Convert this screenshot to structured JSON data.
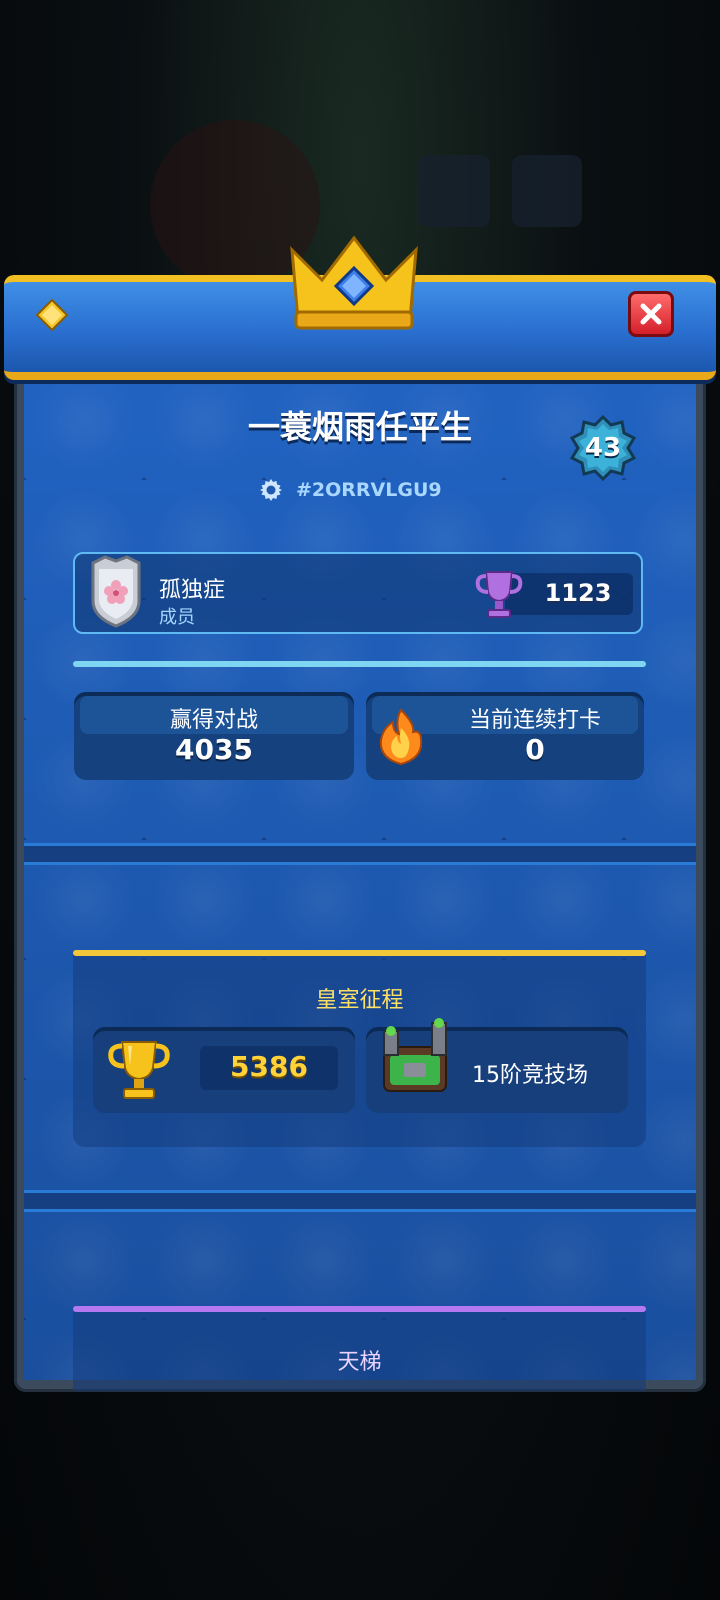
{
  "player": {
    "name": "一蓑烟雨任平生",
    "tag": "#2ORRVLGU9",
    "level": "43"
  },
  "clan": {
    "name": "孤独症",
    "role": "成员",
    "trophies": "1123"
  },
  "stats": {
    "wins_label": "赢得对战",
    "wins_value": "4035",
    "streak_label": "当前连续打卡",
    "streak_value": "0"
  },
  "path_of_legends": {
    "title": "皇室征程",
    "trophies": "5386",
    "arena": "15阶竞技场"
  },
  "ladder": {
    "title": "天梯"
  },
  "icons": {
    "close": "close-icon",
    "gear": "gear-icon",
    "crown": "crown-icon",
    "diamond": "diamond-icon",
    "flame": "flame-icon",
    "trophy_purple": "trophy-icon",
    "trophy_gold": "trophy-icon"
  },
  "colors": {
    "panel_blue": "#1f5ab0",
    "header_gold": "#f2c022",
    "close_red": "#d4202a",
    "trophy_gold_text": "#ffd23a",
    "path_title": "#ffe066",
    "ladder_bar": "#b478f0",
    "divider_cyan": "#7ed6f2"
  }
}
